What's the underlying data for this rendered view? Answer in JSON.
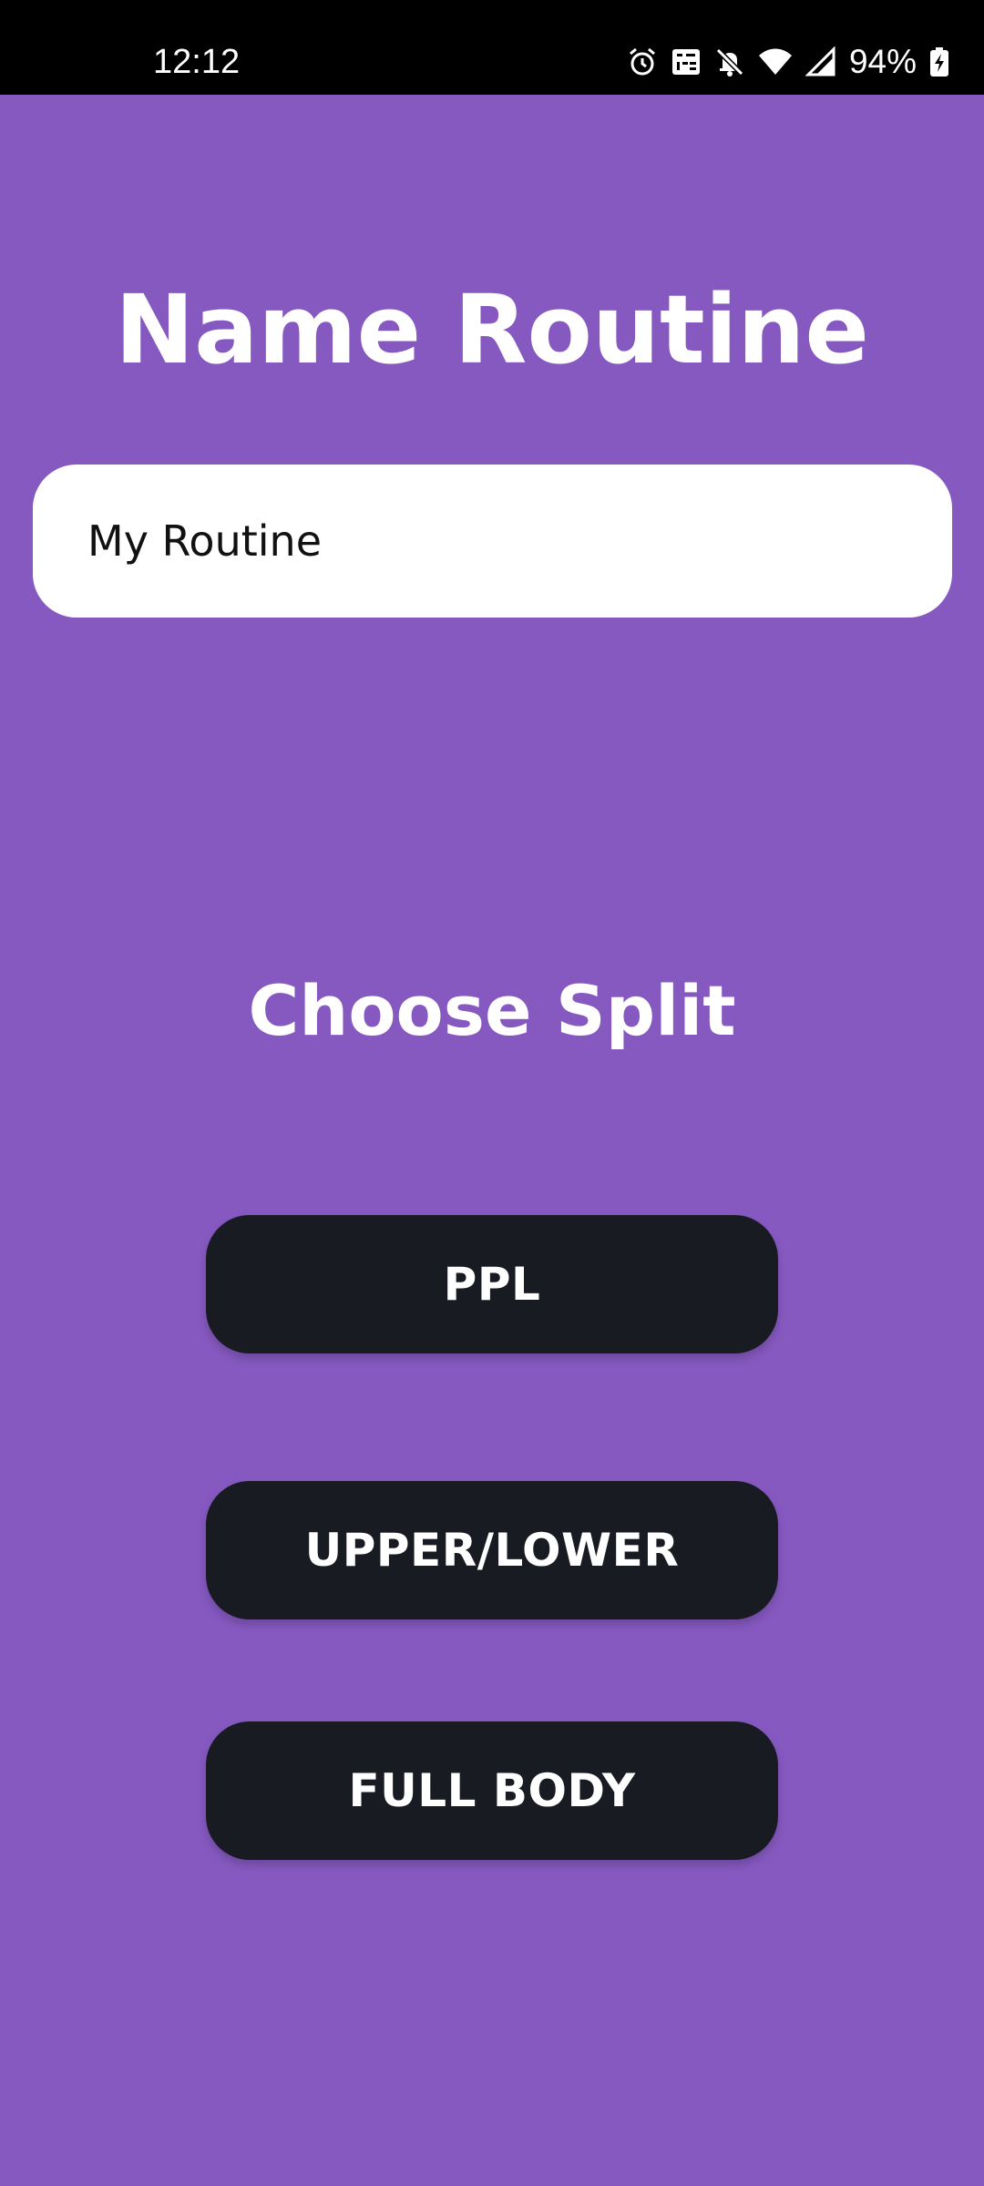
{
  "status_bar": {
    "time": "12:12",
    "battery": "94%",
    "icons": [
      "alarm-icon",
      "volte-icon",
      "mute-icon",
      "wifi-icon",
      "signal-icon",
      "battery-charging-icon"
    ]
  },
  "main": {
    "title": "Name Routine",
    "routine_name_value": "My Routine",
    "split_title": "Choose Split",
    "split_options": [
      "PPL",
      "UPPER/LOWER",
      "FULL BODY"
    ]
  },
  "colors": {
    "background": "#8659c1",
    "button": "#181b22",
    "input": "#ffffff",
    "text": "#ffffff"
  }
}
